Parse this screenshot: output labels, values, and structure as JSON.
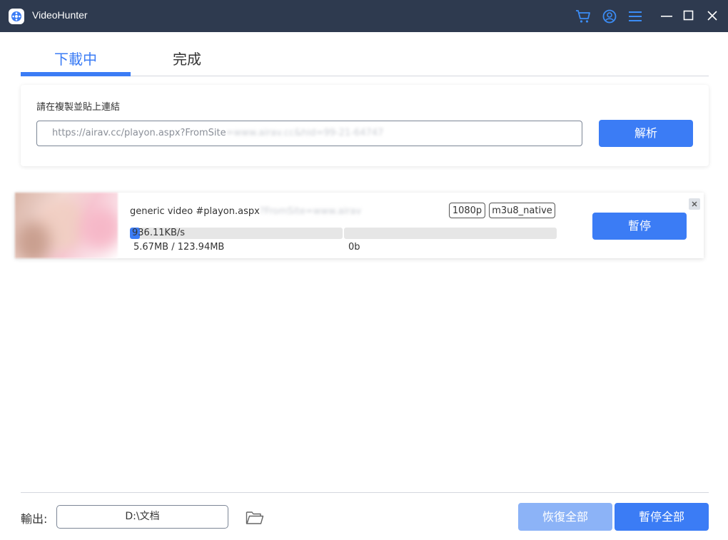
{
  "app": {
    "title": "VideoHunter"
  },
  "titlebar_icons": [
    "cart-icon",
    "account-icon",
    "menu-icon"
  ],
  "window_controls": [
    "minimize-icon",
    "maximize-icon",
    "close-icon"
  ],
  "tabs": [
    {
      "label": "下載中",
      "active": true
    },
    {
      "label": "完成",
      "active": false
    }
  ],
  "url_panel": {
    "label": "請在複製並貼上連結",
    "input_value": "https://airav.cc/playon.aspx?FromSite",
    "input_value_blurred": "=www.airav.cc&hid=99-21-64747",
    "parse_button": "解析"
  },
  "download_item": {
    "title": "generic video #playon.aspx",
    "title_blurred": "?FromSite=www.airav",
    "resolution": "1080p",
    "format": "m3u8_native",
    "speed": "936.11KB/s",
    "progress_fraction": 0.046,
    "size": "5.67MB / 123.94MB",
    "remaining": "0b",
    "pause_button": "暫停"
  },
  "footer": {
    "output_label": "輸出:",
    "output_path": "D:\\文档",
    "resume_all": "恢復全部",
    "pause_all": "暫停全部"
  },
  "colors": {
    "titlebar_bg": "#2e3a4f",
    "accent": "#3b7cf5",
    "accent_disabled": "#8cb3f7"
  }
}
